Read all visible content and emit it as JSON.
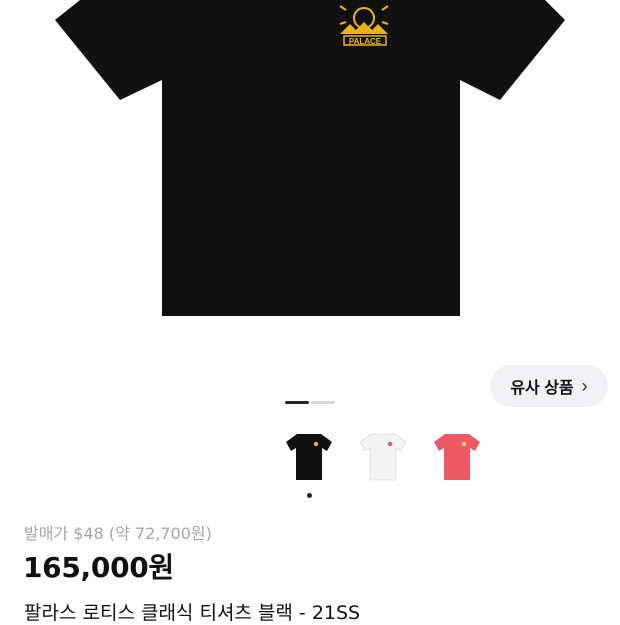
{
  "product": {
    "retail_price": "발매가 $48 (약 72,700원)",
    "price": "165,000원",
    "title": "팔라스 로티스 클래식 티셔츠 블랙 - 21SS",
    "logo_text": "PALACE"
  },
  "similar_button": {
    "label": "유사 상품",
    "icon": "chevron-right-icon"
  },
  "gallery": {
    "current_slide": 1,
    "total_slides": 2
  },
  "variants": [
    {
      "name": "black",
      "color": "#111111"
    },
    {
      "name": "white",
      "color": "#f3f3f3"
    },
    {
      "name": "red",
      "color": "#ee5a63"
    }
  ],
  "colors": {
    "shirt_black": "#111111",
    "print_yellow": "#e8b41a"
  }
}
